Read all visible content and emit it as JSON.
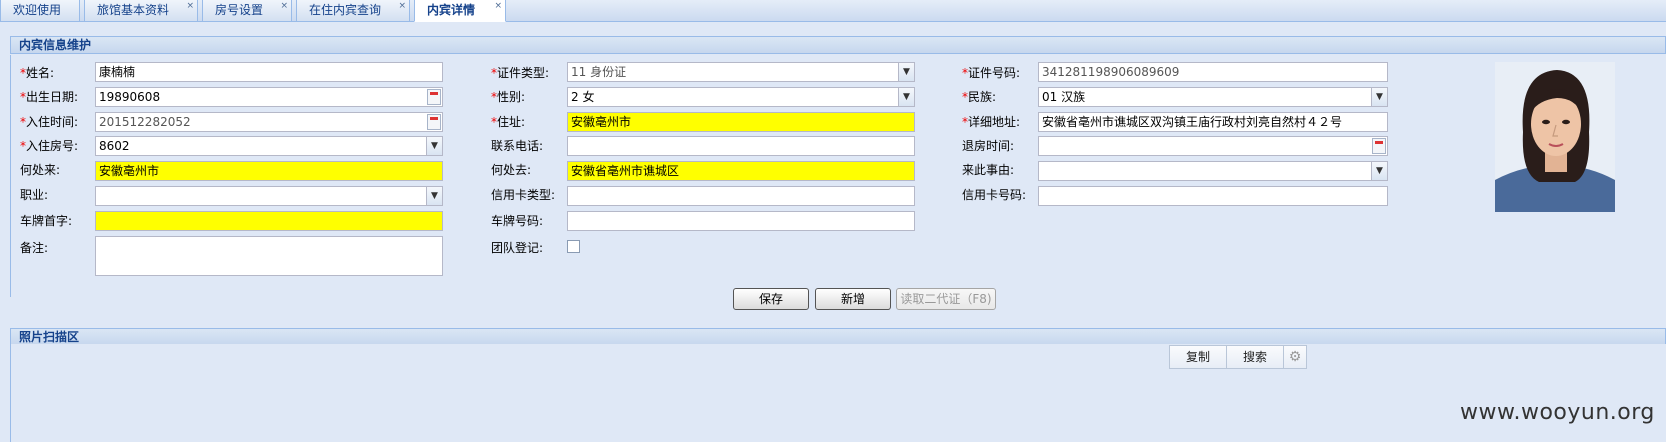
{
  "tabs": [
    {
      "label": "欢迎使用",
      "closable": false
    },
    {
      "label": "旅馆基本资料",
      "closable": true
    },
    {
      "label": "房号设置",
      "closable": true
    },
    {
      "label": "在住内宾查询",
      "closable": true
    },
    {
      "label": "内宾详情",
      "closable": true,
      "active": true
    }
  ],
  "close_glyph": "×",
  "section1_title": "内宾信息维护",
  "section2_title": "照片扫描区",
  "required_mark": "*",
  "form": {
    "name": {
      "label": "姓名:",
      "value": "康楠楠"
    },
    "birth_date": {
      "label": "出生日期:",
      "value": "19890608"
    },
    "checkin_time": {
      "label": "入住时间:",
      "value": "201512282052"
    },
    "room_no": {
      "label": "入住房号:",
      "value": "8602"
    },
    "came_from": {
      "label": "何处来:",
      "value": "安徽亳州市"
    },
    "occupation": {
      "label": "职业:",
      "value": ""
    },
    "plate_prefix": {
      "label": "车牌首字:",
      "value": ""
    },
    "remarks": {
      "label": "备注:",
      "value": ""
    },
    "id_type": {
      "label": "证件类型:",
      "value": "11  身份证"
    },
    "gender": {
      "label": "性别:",
      "value": "2  女"
    },
    "address": {
      "label": "住址:",
      "value": "安徽亳州市"
    },
    "phone": {
      "label": "联系电话:",
      "value": ""
    },
    "going_to": {
      "label": "何处去:",
      "value": "安徽省亳州市谯城区"
    },
    "card_type": {
      "label": "信用卡类型:",
      "value": ""
    },
    "plate_no": {
      "label": "车牌号码:",
      "value": ""
    },
    "group_reg": {
      "label": "团队登记:",
      "checked": false
    },
    "id_no": {
      "label": "证件号码:",
      "value": "341281198906089609"
    },
    "ethnicity": {
      "label": "民族:",
      "value": "01  汉族"
    },
    "detail_address": {
      "label": "详细地址:",
      "value": "安徽省亳州市谯城区双沟镇王庙行政村刘亮自然村４２号"
    },
    "checkout_time": {
      "label": "退房时间:",
      "value": ""
    },
    "reason": {
      "label": "来此事由:",
      "value": ""
    },
    "card_no": {
      "label": "信用卡号码:",
      "value": ""
    }
  },
  "buttons": {
    "save": "保存",
    "add": "新增",
    "read_id": "读取二代证（F8)"
  },
  "scan_toolbar": {
    "copy": "复制",
    "search": "搜索"
  },
  "watermark": "www.wooyun.org",
  "colors": {
    "highlight": "#ffff00",
    "required": "#ee0000",
    "header_text": "#15428b",
    "background": "#dfe8f6"
  },
  "icons": [
    "close-icon",
    "dropdown-arrow-icon",
    "calendar-icon",
    "gear-icon"
  ]
}
